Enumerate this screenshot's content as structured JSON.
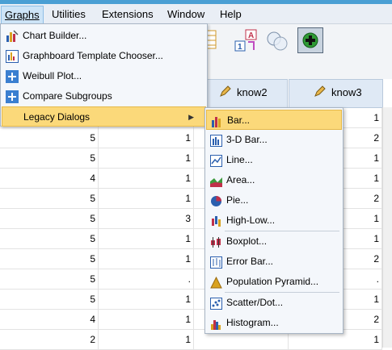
{
  "menubar": {
    "items": [
      {
        "label": "Graphs",
        "open": true
      },
      {
        "label": "Utilities"
      },
      {
        "label": "Extensions"
      },
      {
        "label": "Window"
      },
      {
        "label": "Help"
      }
    ]
  },
  "graphs_menu": {
    "items": [
      {
        "label": "Chart Builder...",
        "icon": "chart-builder-icon"
      },
      {
        "label": "Graphboard Template Chooser...",
        "icon": "graphboard-icon"
      },
      {
        "label": "Weibull Plot...",
        "icon": "plus-box-icon"
      },
      {
        "label": "Compare Subgroups",
        "icon": "plus-box-icon"
      },
      {
        "label": "Legacy Dialogs",
        "submenu": true,
        "highlighted": true,
        "arrow": "▶"
      }
    ]
  },
  "legacy_menu": {
    "items": [
      {
        "label": "Bar...",
        "icon": "bar-chart-icon",
        "highlighted": true
      },
      {
        "label": "3-D Bar...",
        "icon": "3d-bar-icon"
      },
      {
        "label": "Line...",
        "icon": "line-chart-icon"
      },
      {
        "label": "Area...",
        "icon": "area-chart-icon"
      },
      {
        "label": "Pie...",
        "icon": "pie-chart-icon"
      },
      {
        "label": "High-Low...",
        "icon": "high-low-icon"
      },
      {
        "label": "Boxplot...",
        "icon": "boxplot-icon"
      },
      {
        "label": "Error Bar...",
        "icon": "error-bar-icon"
      },
      {
        "label": "Population Pyramid...",
        "icon": "pyramid-icon"
      },
      {
        "label": "Scatter/Dot...",
        "icon": "scatter-icon"
      },
      {
        "label": "Histogram...",
        "icon": "histogram-icon"
      }
    ]
  },
  "grid": {
    "columns": [
      "know2",
      "know3"
    ],
    "rows": [
      [
        "5",
        "1",
        "",
        "1"
      ],
      [
        "5",
        "1",
        "",
        "2"
      ],
      [
        "5",
        "1",
        "",
        "1"
      ],
      [
        "4",
        "1",
        "",
        "1"
      ],
      [
        "5",
        "1",
        "",
        "2"
      ],
      [
        "5",
        "3",
        "",
        "1"
      ],
      [
        "5",
        "1",
        "",
        "1"
      ],
      [
        "5",
        "1",
        "",
        "2"
      ],
      [
        "5",
        ".",
        "",
        "."
      ],
      [
        "5",
        "1",
        "",
        "1"
      ],
      [
        "4",
        "1",
        "",
        "2"
      ],
      [
        "2",
        "1",
        "",
        "1"
      ]
    ]
  }
}
